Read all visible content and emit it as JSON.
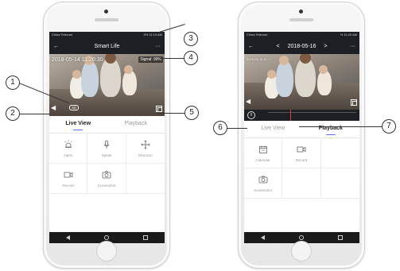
{
  "left_phone": {
    "status": {
      "carrier": "China Telecom",
      "right": "9% 11:19 AM"
    },
    "appbar": {
      "title": "Smart Life",
      "back": "←",
      "more": "···"
    },
    "video": {
      "timestamp": "2018-05-14  11:20:30",
      "signal": "Signal: 99%",
      "sd": "SD"
    },
    "tabs": [
      {
        "label": "Live View",
        "active": true
      },
      {
        "label": "Playback",
        "active": false
      }
    ],
    "grid": [
      {
        "label": "Alarm",
        "icon": "alarm-icon"
      },
      {
        "label": "Speak",
        "icon": "microphone-icon"
      },
      {
        "label": "Direction",
        "icon": "direction-icon"
      },
      {
        "label": "Record",
        "icon": "record-icon"
      },
      {
        "label": "Screenshot",
        "icon": "camera-icon"
      },
      {
        "label": "",
        "icon": ""
      }
    ]
  },
  "right_phone": {
    "status": {
      "carrier": "China Telecom",
      "right": "% 11:20 AM"
    },
    "appbar": {
      "back": "←",
      "prev": "<",
      "date": "2018-05-16",
      "next": ">",
      "more": "···"
    },
    "video": {
      "timestamp": "2018-05-16 11:..."
    },
    "tabs": [
      {
        "label": "Live View",
        "active": false
      },
      {
        "label": "Playback",
        "active": true
      }
    ],
    "grid": [
      {
        "label": "Calendar",
        "icon": "calendar-icon"
      },
      {
        "label": "Record",
        "icon": "record-icon"
      },
      {
        "label": "",
        "icon": ""
      },
      {
        "label": "Screenshot",
        "icon": "camera-icon"
      },
      {
        "label": "",
        "icon": ""
      },
      {
        "label": "",
        "icon": ""
      }
    ]
  },
  "callouts": [
    "1",
    "2",
    "3",
    "4",
    "5",
    "6",
    "7"
  ]
}
